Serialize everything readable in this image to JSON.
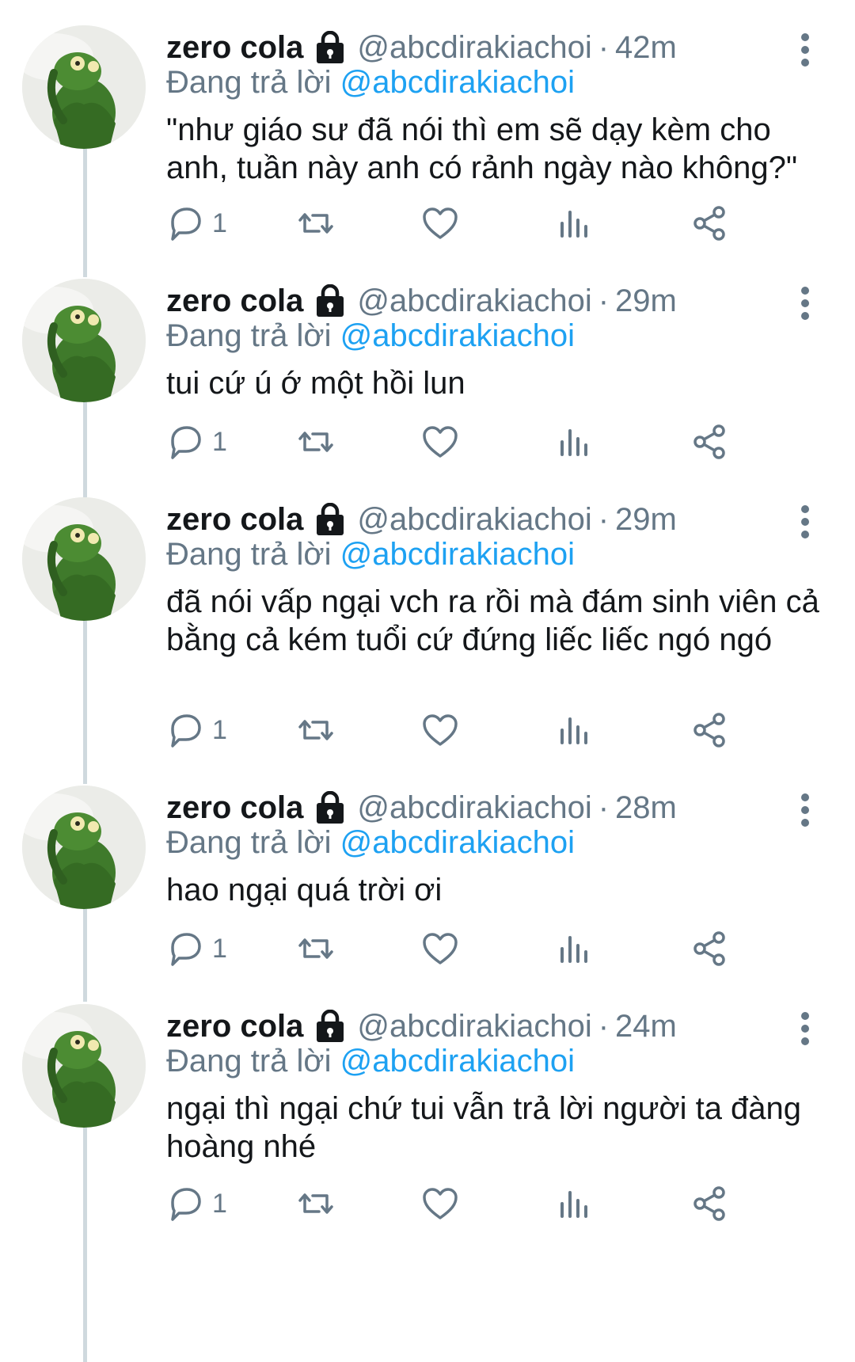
{
  "tweets": [
    {
      "name": "zero cola",
      "handle": "@abcdirakiachoi",
      "separator": "·",
      "time": "42m",
      "reply_prefix": "Đang trả lời",
      "reply_to": "@abcdirakiachoi",
      "text": "\"như giáo sư đã nói thì em sẽ dạy kèm cho anh, tuần này anh có rảnh ngày nào không?\"",
      "reply_count": "1"
    },
    {
      "name": "zero cola",
      "handle": "@abcdirakiachoi",
      "separator": "·",
      "time": "29m",
      "reply_prefix": "Đang trả lời",
      "reply_to": "@abcdirakiachoi",
      "text": "tui cứ ú ớ một hồi lun",
      "reply_count": "1"
    },
    {
      "name": "zero cola",
      "handle": "@abcdirakiachoi",
      "separator": "·",
      "time": "29m",
      "reply_prefix": "Đang trả lời",
      "reply_to": "@abcdirakiachoi",
      "text": "đã nói vấp ngại vch ra rồi mà đám sinh viên cả bằng cả kém tuổi cứ đứng liếc liếc ngó ngó",
      "reply_count": "1"
    },
    {
      "name": "zero cola",
      "handle": "@abcdirakiachoi",
      "separator": "·",
      "time": "28m",
      "reply_prefix": "Đang trả lời",
      "reply_to": "@abcdirakiachoi",
      "text": "hao ngại quá trời ơi",
      "reply_count": "1"
    },
    {
      "name": "zero cola",
      "handle": "@abcdirakiachoi",
      "separator": "·",
      "time": "24m",
      "reply_prefix": "Đang trả lời",
      "reply_to": "@abcdirakiachoi",
      "text": "ngại thì ngại chứ tui vẫn trả lời người ta đàng hoàng nhé",
      "reply_count": "1"
    }
  ],
  "icons": {
    "avatar": "kermit-frog-avatar",
    "protected": "lock-icon",
    "more": "more-vertical-icon",
    "reply": "reply-icon",
    "retweet": "retweet-icon",
    "like": "heart-icon",
    "analytics": "analytics-icon",
    "share": "share-icon"
  },
  "colors": {
    "mention": "#1da1f2",
    "secondary_text": "#657786",
    "thread_line": "#cfd9de"
  }
}
